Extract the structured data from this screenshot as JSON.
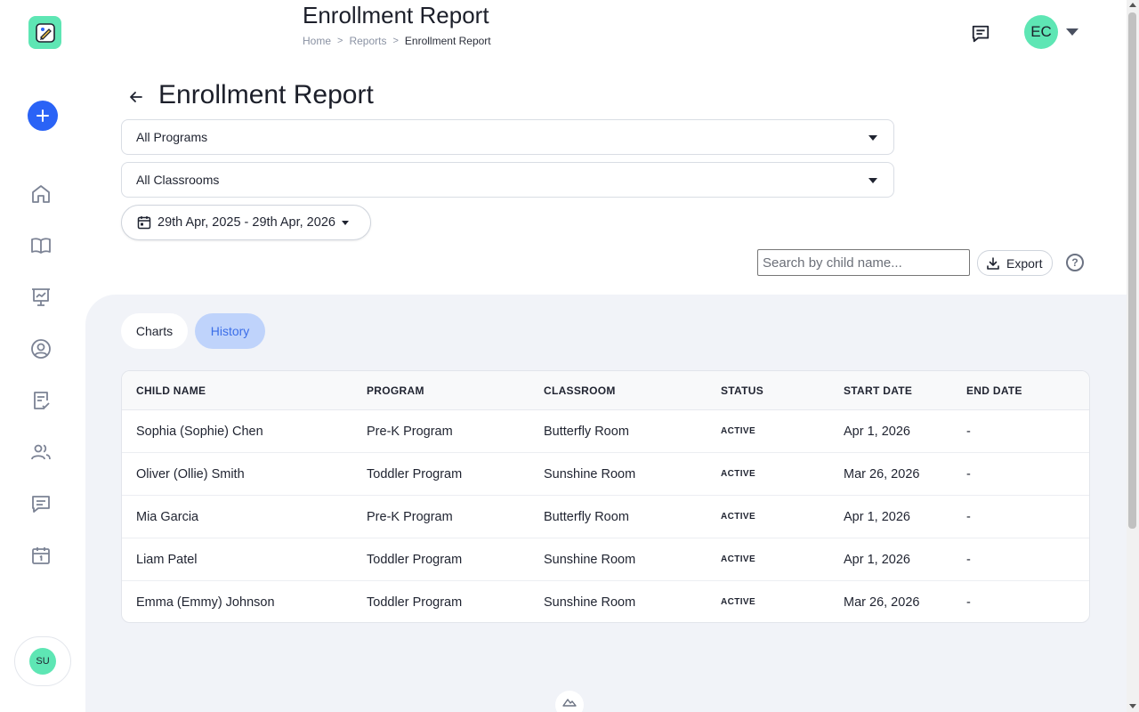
{
  "header": {
    "title": "Enrollment Report",
    "breadcrumb": [
      "Home",
      "Reports",
      "Enrollment Report"
    ],
    "avatar_initials": "EC"
  },
  "sidebar": {
    "items": [
      "home-icon",
      "book-icon",
      "presentation-icon",
      "profile-icon",
      "clipboard-check-icon",
      "users-icon",
      "chat-icon",
      "calendar-icon"
    ],
    "user_initials": "SU"
  },
  "page": {
    "title": "Enrollment Report",
    "program_select": "All Programs",
    "classroom_select": "All Classrooms",
    "date_range": "29th Apr, 2025 - 29th Apr, 2026",
    "search_placeholder": "Search by child name...",
    "export_label": "Export",
    "help_label": "?"
  },
  "tabs": [
    {
      "label": "Charts",
      "active": false
    },
    {
      "label": "History",
      "active": true
    }
  ],
  "table": {
    "columns": [
      "CHILD NAME",
      "PROGRAM",
      "CLASSROOM",
      "STATUS",
      "START DATE",
      "END DATE"
    ],
    "rows": [
      [
        "Sophia (Sophie) Chen",
        "Pre-K Program",
        "Butterfly Room",
        "ACTIVE",
        "Apr 1, 2026",
        "-"
      ],
      [
        "Oliver (Ollie) Smith",
        "Toddler Program",
        "Sunshine Room",
        "ACTIVE",
        "Mar 26, 2026",
        "-"
      ],
      [
        "Mia Garcia",
        "Pre-K Program",
        "Butterfly Room",
        "ACTIVE",
        "Apr 1, 2026",
        "-"
      ],
      [
        "Liam Patel",
        "Toddler Program",
        "Sunshine Room",
        "ACTIVE",
        "Apr 1, 2026",
        "-"
      ],
      [
        "Emma (Emmy) Johnson",
        "Toddler Program",
        "Sunshine Room",
        "ACTIVE",
        "Mar 26, 2026",
        "-"
      ]
    ]
  },
  "colors": {
    "accent": "#2a63f6",
    "mint": "#5ee6b4",
    "active_tab_bg": "#bfd3fb",
    "active_tab_text": "#3b6ee8",
    "panel_bg": "#f1f3f8"
  }
}
